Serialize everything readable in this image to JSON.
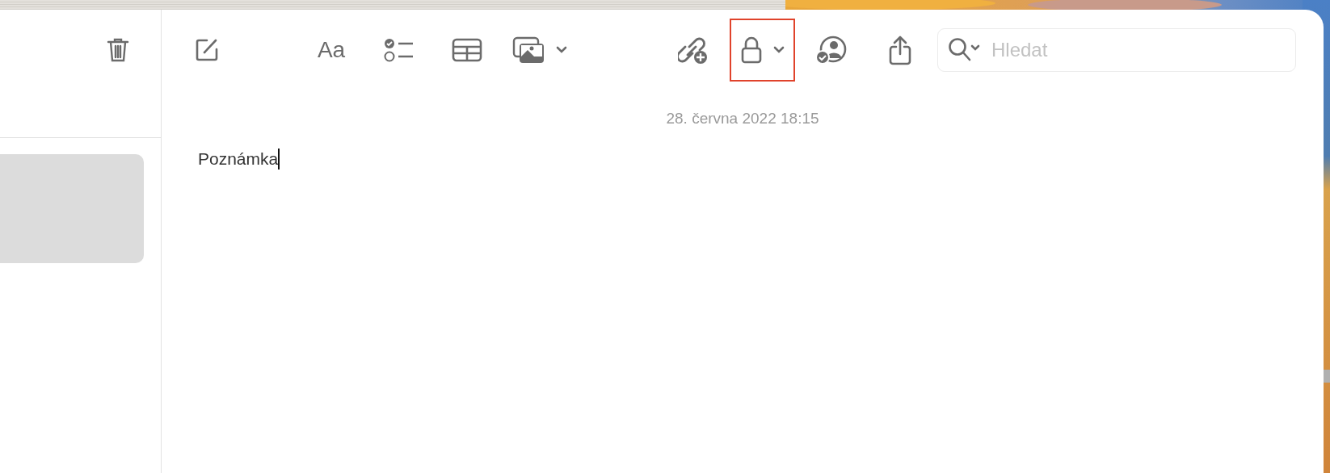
{
  "sidebar": {
    "toolbar": [
      {
        "kind": "trash",
        "dropdown": false,
        "highlighted": false
      }
    ],
    "notes": [
      {
        "selected": true
      }
    ]
  },
  "toolbar": [
    {
      "kind": "compose",
      "dropdown": false,
      "highlighted": false
    },
    {
      "kind": "format",
      "label": "Aa",
      "dropdown": false,
      "highlighted": false
    },
    {
      "kind": "checklist",
      "dropdown": false,
      "highlighted": false
    },
    {
      "kind": "table",
      "dropdown": false,
      "highlighted": false
    },
    {
      "kind": "media",
      "dropdown": true,
      "highlighted": false
    },
    {
      "kind": "link",
      "dropdown": false,
      "highlighted": false
    },
    {
      "kind": "lock",
      "dropdown": true,
      "highlighted": true
    },
    {
      "kind": "collaborate",
      "dropdown": false,
      "highlighted": false
    },
    {
      "kind": "share",
      "dropdown": false,
      "highlighted": false
    }
  ],
  "search": {
    "placeholder": "Hledat"
  },
  "note": {
    "date": "28. června 2022 18:15",
    "body": "Poznámka"
  }
}
